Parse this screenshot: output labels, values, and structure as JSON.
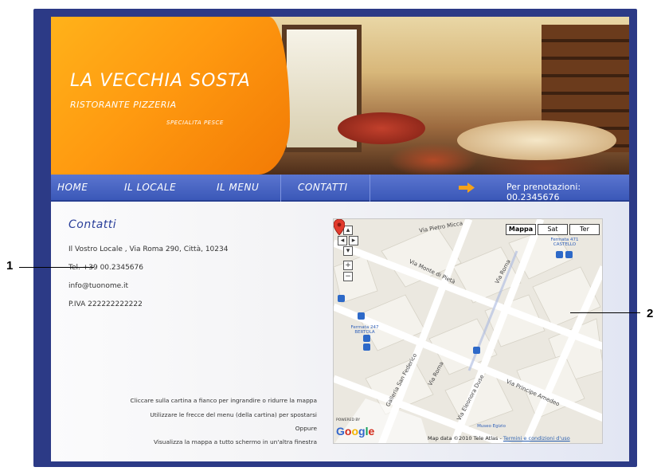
{
  "site": {
    "brand_title": "LA VECCHIA SOSTA",
    "brand_subtitle": "RISTORANTE PIZZERIA",
    "brand_specialty": "SPECIALITA PESCE"
  },
  "nav": {
    "items": [
      {
        "label": "HOME"
      },
      {
        "label": "IL LOCALE"
      },
      {
        "label": "IL MENU"
      },
      {
        "label": "CONTATTI"
      }
    ],
    "booking_text": "Per prenotazioni: 00.2345676"
  },
  "contact": {
    "title": "Contatti",
    "address": "Il Vostro Locale , Via Roma 290, Città, 10234",
    "phone": "Tel. +39 00.2345676",
    "email": "info@tuonome.it",
    "vat": "P.IVA 222222222222"
  },
  "help_lines": [
    "Cliccare sulla cartina a fianco per ingrandire o ridurre la mappa",
    "Utilizzare le frecce del menu (della cartina) per spostarsi",
    "Oppure",
    "Visualizza la mappa a tutto schermo in un'altra finestra"
  ],
  "map": {
    "type_buttons": [
      "Mappa",
      "Sat",
      "Ter"
    ],
    "streets": [
      "Via Pietro Micca",
      "Via Monte di Pietà",
      "Via Roma",
      "Galleria San Federico",
      "Via Roma",
      "Via Eleonora Duse",
      "Via Principe Amedeo"
    ],
    "stops": [
      "Fermata 471 CASTELLO",
      "Fermata 247 BERTOLA",
      "Museo Egizio"
    ],
    "powered_by": "POWERED BY",
    "google": "Google",
    "copyright": "Map data ©2010 Tele Atlas - ",
    "terms": "Termini e condizioni d'uso"
  },
  "annotations": {
    "label_1": "1",
    "label_2": "2"
  },
  "colors": {
    "frame": "#2c3a86",
    "nav": "#3b58b8",
    "brand_orange": "#ff9a10",
    "title_blue": "#2a3f9a"
  }
}
